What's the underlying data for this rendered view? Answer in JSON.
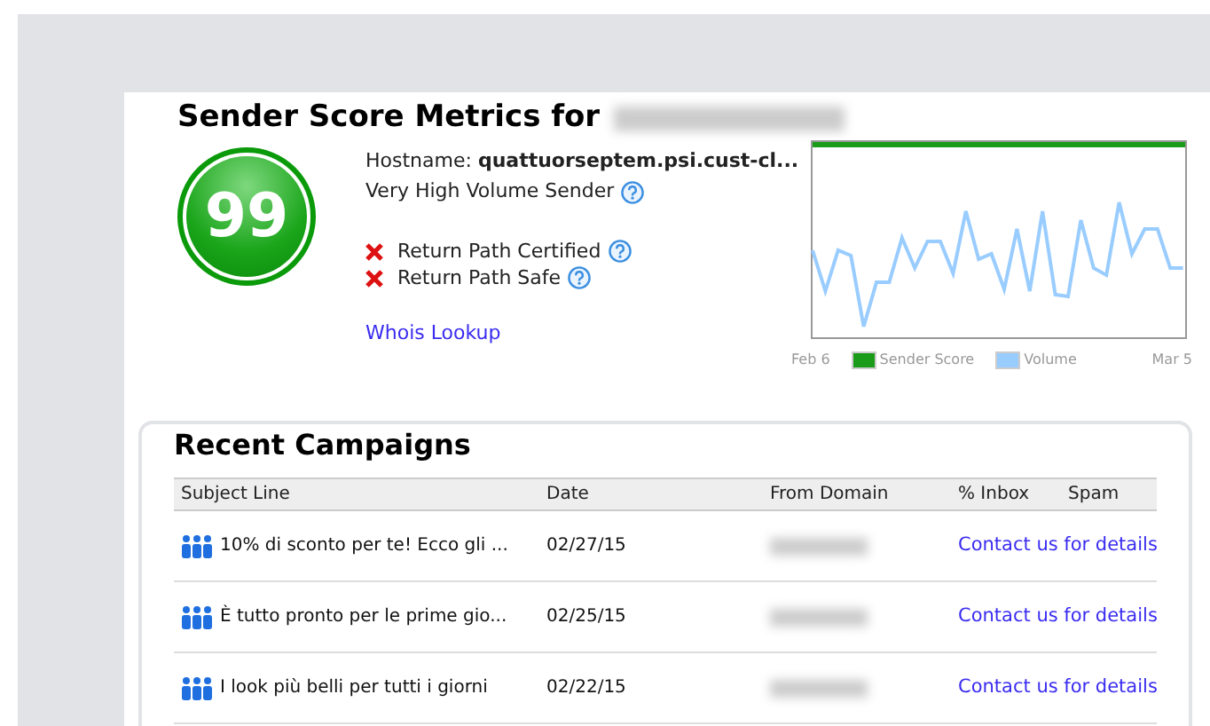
{
  "title": "Sender Score Metrics for",
  "score": "99",
  "hostname": {
    "label": "Hostname:",
    "value": "quattuorseptem.psi.cust-cl..."
  },
  "volume_class": "Very High Volume Sender",
  "certifications": [
    {
      "label": "Return Path Certified",
      "certified": false
    },
    {
      "label": "Return Path Safe",
      "certified": false
    }
  ],
  "whois_link": "Whois Lookup",
  "chart": {
    "start": "Feb 6",
    "end": "Mar 5",
    "legend": [
      {
        "label": "Sender Score",
        "color": "#1a9b1a"
      },
      {
        "label": "Volume",
        "color": "#99ccff"
      }
    ]
  },
  "campaigns": {
    "title": "Recent Campaigns",
    "columns": [
      "Subject Line",
      "Date",
      "From Domain",
      "% Inbox",
      "Spam"
    ],
    "rows": [
      {
        "subject": "10% di sconto per te! Ecco gli ...",
        "date": "02/27/15",
        "inbox": "Contact us for details"
      },
      {
        "subject": "È tutto pronto per le prime gio...",
        "date": "02/25/15",
        "inbox": "Contact us for details"
      },
      {
        "subject": "I look più belli per tutti i giorni",
        "date": "02/22/15",
        "inbox": "Contact us for details"
      }
    ]
  }
}
